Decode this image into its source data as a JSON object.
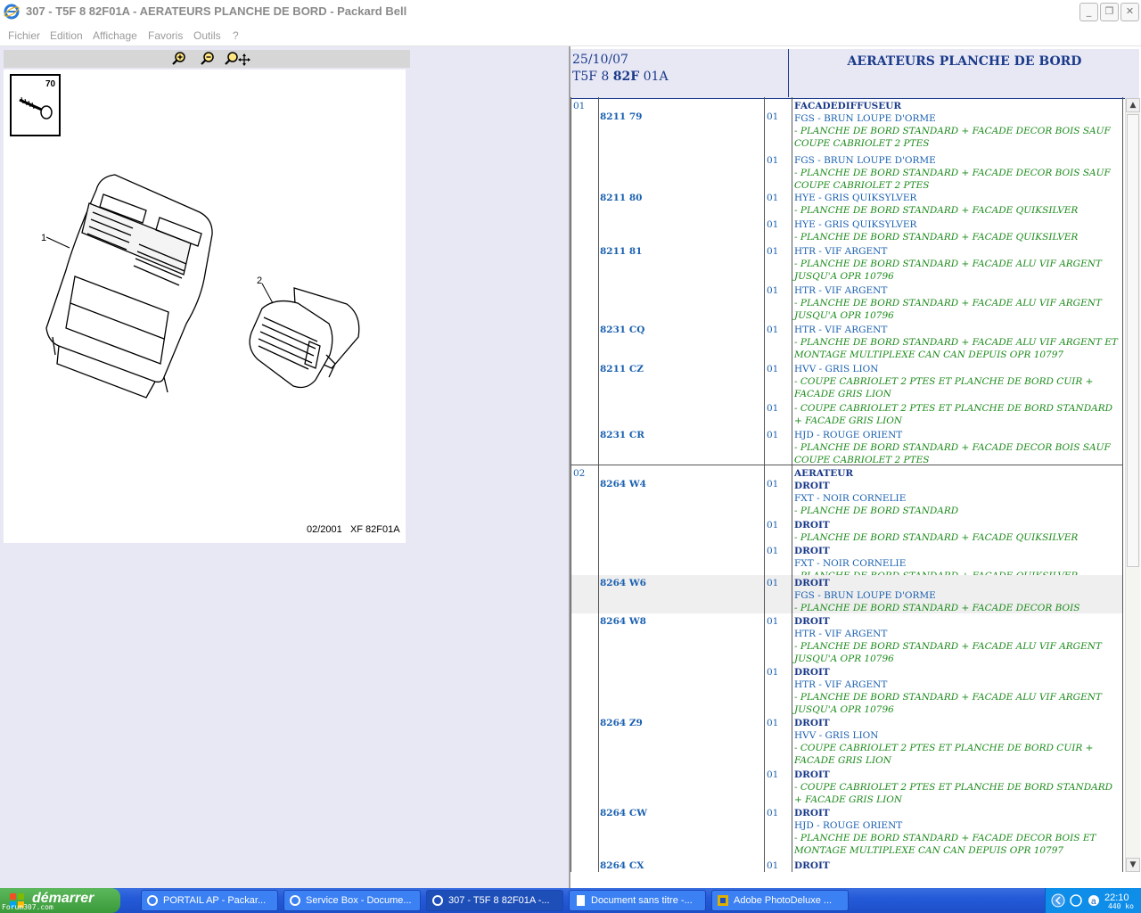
{
  "window": {
    "title": "307 - T5F 8 82F01A - AERATEURS PLANCHE DE BORD - Packard Bell",
    "controls": {
      "minimize": "_",
      "restore": "❐",
      "close": "✕"
    }
  },
  "menu": [
    "Fichier",
    "Edition",
    "Affichage",
    "Favoris",
    "Outils",
    "?"
  ],
  "drawing": {
    "callouts": [
      "70",
      "1",
      "2"
    ],
    "caption_date": "02/2001",
    "caption_ref": "XF 82F01A"
  },
  "header": {
    "date": "25/10/07",
    "ref_pre": "T5F 8 ",
    "ref_bold": "82F",
    "ref_post": " 01A",
    "title": "AERATEURS PLANCHE DE BORD"
  },
  "table": {
    "rows": [
      {
        "grp": "01",
        "pno": "8211 79",
        "qty": "01",
        "lines": [
          {
            "k": "h",
            "t": "FACADEDIFFUSEUR"
          },
          {
            "k": "c",
            "t": "FGS - BRUN LOUPE D'ORME"
          },
          {
            "k": "n",
            "t": "- PLANCHE DE BORD STANDARD + FACADE DECOR BOIS SAUF COUPE CABRIOLET 2 PTES"
          }
        ]
      },
      {
        "grp": "",
        "pno": "",
        "qty": "01",
        "lines": [
          {
            "k": "c",
            "t": "FGS - BRUN LOUPE D'ORME"
          },
          {
            "k": "n",
            "t": "- PLANCHE DE BORD STANDARD + FACADE DECOR BOIS SAUF COUPE CABRIOLET 2 PTES"
          }
        ]
      },
      {
        "grp": "",
        "pno": "8211 80",
        "qty": "01",
        "lines": [
          {
            "k": "c",
            "t": "HYE - GRIS QUIKSYLVER"
          },
          {
            "k": "n",
            "t": "- PLANCHE DE BORD STANDARD + FACADE QUIKSILVER"
          }
        ]
      },
      {
        "grp": "",
        "pno": "",
        "qty": "01",
        "lines": [
          {
            "k": "c",
            "t": "HYE - GRIS QUIKSYLVER"
          },
          {
            "k": "n",
            "t": "- PLANCHE DE BORD STANDARD + FACADE QUIKSILVER"
          }
        ]
      },
      {
        "grp": "",
        "pno": "8211 81",
        "qty": "01",
        "lines": [
          {
            "k": "c",
            "t": "HTR - VIF ARGENT"
          },
          {
            "k": "n",
            "t": "- PLANCHE DE BORD STANDARD + FACADE ALU VIF ARGENT JUSQU'A OPR 10796"
          }
        ]
      },
      {
        "grp": "",
        "pno": "",
        "qty": "01",
        "lines": [
          {
            "k": "c",
            "t": "HTR - VIF ARGENT"
          },
          {
            "k": "n",
            "t": "- PLANCHE DE BORD STANDARD + FACADE ALU VIF ARGENT JUSQU'A OPR 10796"
          }
        ]
      },
      {
        "grp": "",
        "pno": "8231 CQ",
        "qty": "01",
        "lines": [
          {
            "k": "c",
            "t": "HTR - VIF ARGENT"
          },
          {
            "k": "n",
            "t": "- PLANCHE DE BORD STANDARD + FACADE ALU VIF ARGENT ET MONTAGE MULTIPLEXE CAN CAN DEPUIS OPR 10797"
          }
        ]
      },
      {
        "grp": "",
        "pno": "8211 CZ",
        "qty": "01",
        "lines": [
          {
            "k": "c",
            "t": "HVV - GRIS LION"
          },
          {
            "k": "n",
            "t": "- COUPE CABRIOLET 2 PTES ET PLANCHE DE BORD CUIR + FACADE GRIS LION"
          }
        ]
      },
      {
        "grp": "",
        "pno": "",
        "qty": "01",
        "lines": [
          {
            "k": "n",
            "t": "- COUPE CABRIOLET 2 PTES ET PLANCHE DE BORD STANDARD + FACADE GRIS LION"
          }
        ]
      },
      {
        "grp": "",
        "pno": "8231 CR",
        "qty": "01",
        "lines": [
          {
            "k": "c",
            "t": "HJD - ROUGE ORIENT"
          },
          {
            "k": "n",
            "t": "- PLANCHE DE BORD STANDARD + FACADE DECOR BOIS SAUF COUPE CABRIOLET 2 PTES"
          }
        ]
      },
      {
        "grp": "02",
        "pno": "8264 W4",
        "qty": "01",
        "lines": [
          {
            "k": "h",
            "t": "AERATEUR"
          },
          {
            "k": "h",
            "t": "DROIT"
          },
          {
            "k": "c",
            "t": "FXT - NOIR CORNELIE"
          },
          {
            "k": "n",
            "t": "- PLANCHE DE BORD STANDARD"
          }
        ]
      },
      {
        "grp": "",
        "pno": "",
        "qty": "01",
        "lines": [
          {
            "k": "h",
            "t": "DROIT"
          },
          {
            "k": "n",
            "t": "- PLANCHE DE BORD STANDARD + FACADE QUIKSILVER"
          }
        ]
      },
      {
        "grp": "",
        "pno": "",
        "qty": "01",
        "lines": [
          {
            "k": "h",
            "t": "DROIT"
          },
          {
            "k": "c",
            "t": "FXT - NOIR CORNELIE"
          },
          {
            "k": "n",
            "t": "- PLANCHE DE BORD STANDARD + FACADE QUIKSILVER"
          }
        ]
      },
      {
        "grp": "",
        "pno": "8264 W6",
        "qty": "01",
        "hl": true,
        "lines": [
          {
            "k": "h",
            "t": "DROIT"
          },
          {
            "k": "c",
            "t": "FGS - BRUN LOUPE D'ORME"
          },
          {
            "k": "n",
            "t": "- PLANCHE DE BORD STANDARD + FACADE DECOR BOIS"
          }
        ]
      },
      {
        "grp": "",
        "pno": "8264 W8",
        "qty": "01",
        "lines": [
          {
            "k": "h",
            "t": "DROIT"
          },
          {
            "k": "c",
            "t": "HTR - VIF ARGENT"
          },
          {
            "k": "n",
            "t": "- PLANCHE DE BORD STANDARD + FACADE ALU VIF ARGENT JUSQU'A OPR 10796"
          }
        ]
      },
      {
        "grp": "",
        "pno": "",
        "qty": "01",
        "lines": [
          {
            "k": "h",
            "t": "DROIT"
          },
          {
            "k": "c",
            "t": "HTR - VIF ARGENT"
          },
          {
            "k": "n",
            "t": "- PLANCHE DE BORD STANDARD + FACADE ALU VIF ARGENT JUSQU'A OPR 10796"
          }
        ]
      },
      {
        "grp": "",
        "pno": "8264 Z9",
        "qty": "01",
        "lines": [
          {
            "k": "h",
            "t": "DROIT"
          },
          {
            "k": "c",
            "t": "HVV - GRIS LION"
          },
          {
            "k": "n",
            "t": "- COUPE CABRIOLET 2 PTES ET PLANCHE DE BORD CUIR + FACADE GRIS LION"
          }
        ]
      },
      {
        "grp": "",
        "pno": "",
        "qty": "01",
        "lines": [
          {
            "k": "h",
            "t": "DROIT"
          },
          {
            "k": "n",
            "t": "- COUPE CABRIOLET 2 PTES ET PLANCHE DE BORD STANDARD + FACADE GRIS LION"
          }
        ]
      },
      {
        "grp": "",
        "pno": "8264 CW",
        "qty": "01",
        "lines": [
          {
            "k": "h",
            "t": "DROIT"
          },
          {
            "k": "c",
            "t": "HJD - ROUGE ORIENT"
          },
          {
            "k": "n",
            "t": "- PLANCHE DE BORD STANDARD + FACADE DECOR BOIS ET MONTAGE MULTIPLEXE CAN CAN DEPUIS OPR 10797"
          }
        ]
      },
      {
        "grp": "",
        "pno": "8264 CX",
        "qty": "01",
        "lines": [
          {
            "k": "h",
            "t": "DROIT"
          }
        ]
      }
    ]
  },
  "scrollbar": {
    "up": "▲",
    "down": "▼"
  },
  "taskbar": {
    "start_label": "démarrer",
    "start_sub": "Forum307.com",
    "tasks": [
      "PORTAIL AP - Packar...",
      "Service Box - Docume...",
      "307 - T5F 8 82F01A -...",
      "Document sans titre -...",
      "Adobe PhotoDeluxe ..."
    ],
    "clock": "22:10",
    "size_label": "440 ko"
  }
}
